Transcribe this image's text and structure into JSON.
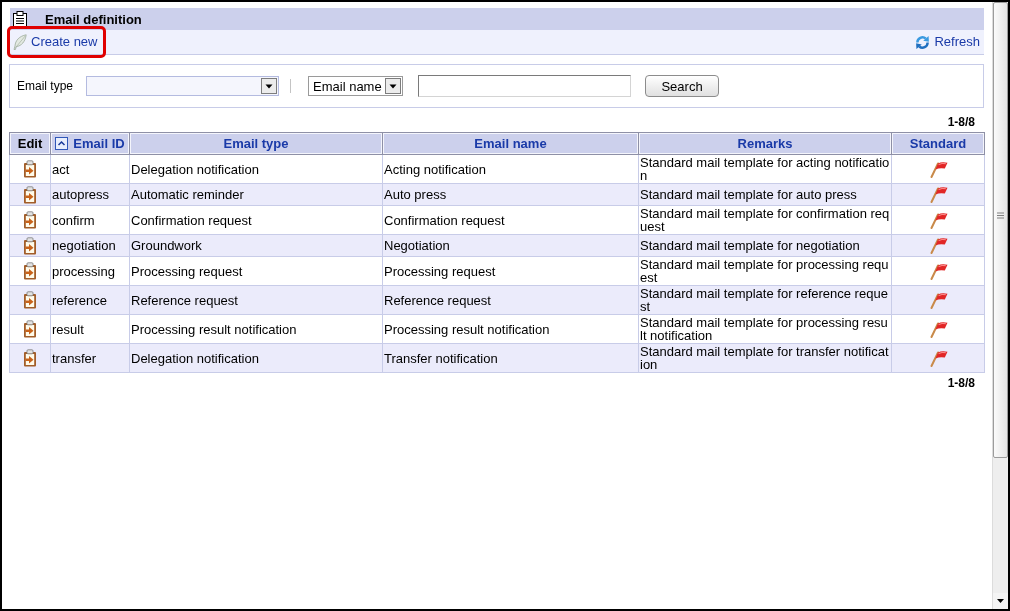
{
  "panel": {
    "title": "Email definition"
  },
  "toolbar": {
    "create_new": {
      "label": "Create new",
      "highlighted": true
    },
    "refresh": {
      "label": "Refresh"
    }
  },
  "search": {
    "type_filter": {
      "label": "Email type"
    },
    "name_selector": {
      "value": "Email name"
    },
    "search_button": "Search"
  },
  "pager_top": "1-8/8",
  "table": {
    "columns": [
      {
        "label": "Edit",
        "sortable": false,
        "sorted": false
      },
      {
        "label": "Email ID",
        "sortable": true,
        "sorted": true
      },
      {
        "label": "Email type",
        "sortable": true,
        "sorted": false
      },
      {
        "label": "Email name",
        "sortable": true,
        "sorted": false
      },
      {
        "label": "Remarks",
        "sortable": true,
        "sorted": false
      },
      {
        "label": "Standard",
        "sortable": true,
        "sorted": false
      }
    ],
    "rows": [
      {
        "id": "act",
        "type": "Delegation notification",
        "name": "Acting notification",
        "remarks": "Standard mail template for acting notification",
        "standard": true
      },
      {
        "id": "autopress",
        "type": "Automatic reminder",
        "name": "Auto press",
        "remarks": "Standard mail template for auto press",
        "standard": true
      },
      {
        "id": "confirm",
        "type": "Confirmation request",
        "name": "Confirmation request",
        "remarks": "Standard mail template for confirmation request",
        "standard": true
      },
      {
        "id": "negotiation",
        "type": "Groundwork",
        "name": "Negotiation",
        "remarks": "Standard mail template for negotiation",
        "standard": true
      },
      {
        "id": "processing",
        "type": "Processing request",
        "name": "Processing request",
        "remarks": "Standard mail template for processing request",
        "standard": true
      },
      {
        "id": "reference",
        "type": "Reference request",
        "name": "Reference request",
        "remarks": "Standard mail template for reference request",
        "standard": true
      },
      {
        "id": "result",
        "type": "Processing result notification",
        "name": "Processing result notification",
        "remarks": "Standard mail template for processing result notification",
        "standard": true
      },
      {
        "id": "transfer",
        "type": "Delegation notification",
        "name": "Transfer notification",
        "remarks": "Standard mail template for transfer notification",
        "standard": true
      }
    ]
  },
  "pager_bottom": "1-8/8"
}
